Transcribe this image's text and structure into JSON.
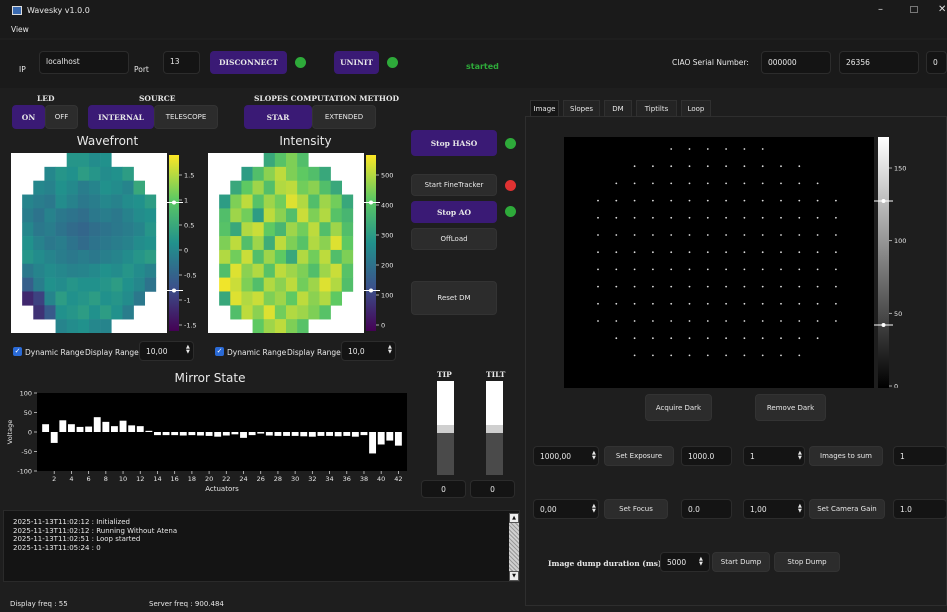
{
  "window": {
    "title": "Wavesky v1.0.0"
  },
  "menu": {
    "view": "View"
  },
  "connection": {
    "ip_label": "IP",
    "ip_value": "localhost",
    "port_label": "Port",
    "port_value": "13",
    "disconnect": "DISCONNECT",
    "uninit": "UNINIT",
    "status": "started",
    "ciao_label": "CIAO Serial Number:",
    "serial1": "000000",
    "serial2": "26356",
    "serial3": "0"
  },
  "led": {
    "title": "LED",
    "on": "ON",
    "off": "OFF"
  },
  "source": {
    "title": "SOURCE",
    "internal": "INTERNAL",
    "telescope": "TELESCOPE"
  },
  "slopes_method": {
    "title": "SLOPES COMPUTATION METHOD",
    "star": "STAR",
    "extended": "EXTENDED"
  },
  "wavefront": {
    "title": "Wavefront",
    "colorbar_ticks": [
      "1.5",
      "1",
      "0.5",
      "0",
      "-0.5",
      "-1",
      "-1.5"
    ],
    "colormap": "viridis",
    "grid": [
      [
        null,
        null,
        null,
        null,
        null,
        0.52,
        0.52,
        0.48,
        0.5,
        null,
        null,
        null,
        null,
        null
      ],
      [
        null,
        null,
        null,
        0.46,
        0.52,
        0.5,
        0.55,
        0.52,
        0.48,
        0.5,
        0.55,
        null,
        null,
        null
      ],
      [
        null,
        null,
        0.46,
        0.44,
        0.5,
        0.47,
        0.42,
        0.45,
        0.5,
        0.48,
        0.45,
        0.6,
        null,
        null
      ],
      [
        null,
        0.45,
        0.42,
        0.4,
        0.48,
        0.44,
        0.4,
        0.42,
        0.46,
        0.44,
        0.48,
        0.5,
        0.55,
        null
      ],
      [
        null,
        0.42,
        0.38,
        0.44,
        0.4,
        0.38,
        0.36,
        0.4,
        0.42,
        0.4,
        0.44,
        0.48,
        0.5,
        null
      ],
      [
        null,
        0.46,
        0.4,
        0.42,
        0.38,
        0.35,
        0.33,
        0.36,
        0.38,
        0.4,
        0.42,
        0.45,
        0.52,
        null
      ],
      [
        null,
        0.5,
        0.44,
        0.4,
        0.42,
        0.38,
        0.35,
        0.38,
        0.4,
        0.42,
        0.44,
        0.48,
        0.5,
        null
      ],
      [
        null,
        0.52,
        0.48,
        0.45,
        0.42,
        0.4,
        0.42,
        0.4,
        0.43,
        0.45,
        0.48,
        0.52,
        0.55,
        null
      ],
      [
        null,
        0.4,
        0.45,
        0.48,
        0.46,
        0.44,
        0.45,
        0.47,
        0.5,
        0.48,
        0.52,
        0.48,
        0.44,
        null
      ],
      [
        null,
        0.3,
        0.42,
        0.5,
        0.48,
        0.52,
        0.5,
        0.5,
        0.52,
        0.55,
        0.5,
        0.46,
        0.38,
        null
      ],
      [
        null,
        0.12,
        0.2,
        0.45,
        0.55,
        0.5,
        0.52,
        0.55,
        0.5,
        0.52,
        0.48,
        0.4,
        null,
        null
      ],
      [
        null,
        null,
        0.15,
        0.28,
        0.5,
        0.52,
        0.55,
        0.5,
        0.55,
        0.5,
        0.42,
        null,
        null,
        null
      ],
      [
        null,
        null,
        null,
        null,
        0.45,
        0.48,
        0.5,
        0.46,
        0.45,
        null,
        null,
        null,
        null,
        null
      ]
    ],
    "dynamic_range": "Dynamic Range",
    "display_range_label": "Display Range:",
    "display_range_value": "10,00"
  },
  "intensity": {
    "title": "Intensity",
    "colorbar_ticks": [
      "500",
      "400",
      "300",
      "200",
      "100",
      "0"
    ],
    "colormap": "viridis",
    "grid": [
      [
        null,
        null,
        null,
        null,
        null,
        0.6,
        0.72,
        0.8,
        0.7,
        null,
        null,
        null,
        null,
        null
      ],
      [
        null,
        null,
        null,
        0.55,
        0.7,
        0.82,
        0.9,
        0.8,
        0.75,
        0.7,
        0.6,
        null,
        null,
        null
      ],
      [
        null,
        null,
        0.6,
        0.75,
        0.85,
        0.7,
        0.88,
        0.9,
        0.78,
        0.82,
        0.7,
        0.6,
        null,
        null
      ],
      [
        null,
        0.55,
        0.8,
        0.9,
        0.72,
        0.85,
        0.78,
        0.95,
        0.88,
        0.7,
        0.85,
        0.78,
        0.6,
        null
      ],
      [
        null,
        0.7,
        0.85,
        0.78,
        0.55,
        0.9,
        0.82,
        0.7,
        0.92,
        0.8,
        0.88,
        0.72,
        0.66,
        null
      ],
      [
        null,
        0.72,
        0.6,
        0.88,
        0.92,
        0.75,
        0.66,
        0.85,
        0.78,
        0.9,
        0.7,
        0.85,
        0.7,
        null
      ],
      [
        null,
        0.8,
        0.9,
        0.7,
        0.85,
        0.62,
        0.9,
        0.8,
        0.72,
        0.88,
        0.82,
        0.95,
        0.75,
        null
      ],
      [
        null,
        0.88,
        0.78,
        0.92,
        0.7,
        0.85,
        0.75,
        0.6,
        0.88,
        0.78,
        0.9,
        0.7,
        0.8,
        null
      ],
      [
        null,
        0.7,
        0.95,
        0.82,
        0.88,
        0.72,
        0.9,
        0.85,
        0.8,
        0.7,
        0.85,
        0.92,
        0.72,
        null
      ],
      [
        null,
        0.98,
        0.92,
        0.8,
        0.7,
        0.88,
        0.82,
        0.9,
        0.78,
        0.85,
        0.95,
        0.88,
        0.7,
        null
      ],
      [
        null,
        0.6,
        0.95,
        0.88,
        0.92,
        0.8,
        0.85,
        0.75,
        0.9,
        0.82,
        0.88,
        0.75,
        null,
        null
      ],
      [
        null,
        null,
        0.7,
        0.9,
        0.82,
        0.95,
        0.78,
        0.88,
        0.85,
        0.8,
        0.72,
        null,
        null,
        null
      ],
      [
        null,
        null,
        null,
        null,
        0.75,
        0.85,
        0.9,
        0.8,
        0.72,
        null,
        null,
        null,
        null,
        null
      ]
    ],
    "dynamic_range": "Dynamic Range",
    "display_range_label": "Display Range:",
    "display_range_value": "10,0"
  },
  "controls": {
    "stop_haso": "Stop HASO",
    "start_finetracker": "Start FineTracker",
    "stop_ao": "Stop AO",
    "offload": "OffLoad",
    "reset_dm": "Reset DM"
  },
  "mirror_state": {
    "title": "Mirror State",
    "chart_data": {
      "type": "bar",
      "xlabel": "Actuators",
      "ylabel": "Voltage",
      "ylim": [
        -100,
        100
      ],
      "yticks": [
        "100",
        "50",
        "0",
        "-50",
        "-100"
      ],
      "xticks": [
        "2",
        "4",
        "6",
        "8",
        "10",
        "12",
        "14",
        "16",
        "18",
        "20",
        "22",
        "24",
        "26",
        "28",
        "30",
        "32",
        "34",
        "36",
        "38",
        "40",
        "42"
      ],
      "values": [
        20,
        -28,
        30,
        20,
        13,
        14,
        38,
        26,
        15,
        29,
        17,
        15,
        3,
        -8,
        -8,
        -8,
        -9,
        -8,
        -9,
        -10,
        -12,
        -9,
        -6,
        -15,
        -8,
        -4,
        -9,
        -10,
        -10,
        -10,
        -11,
        -12,
        -10,
        -10,
        -11,
        -10,
        -12,
        -8,
        -55,
        -32,
        -22,
        -35
      ]
    }
  },
  "tiptilt": {
    "tip": "TIP",
    "tilt": "TILT",
    "tip_value": "0",
    "tilt_value": "0",
    "tip_fill": 0.45,
    "tilt_fill": 0.45
  },
  "log": {
    "lines": [
      "2025-11-13T11:02:12 : Initialized",
      "2025-11-13T11:02:12 : Running Without Atena",
      "2025-11-13T11:02:51 : Loop started",
      "2025-11-13T11:05:24 : 0"
    ]
  },
  "status": {
    "display_freq": "Display freq : 55",
    "server_freq": "Server freq : 900.484"
  },
  "tabs": [
    "Image",
    "Slopes",
    "DM",
    "Tiptilts",
    "Loop"
  ],
  "camera": {
    "colorbar_ticks": [
      "150",
      "100",
      "50",
      "0"
    ],
    "acquire_dark": "Acquire Dark",
    "remove_dark": "Remove Dark",
    "exposure_input": "1000,00",
    "set_exposure": "Set Exposure",
    "exposure_value": "1000.0",
    "images_input": "1",
    "images_to_sum": "Images to sum",
    "images_value": "1",
    "focus_input": "0,00",
    "set_focus": "Set Focus",
    "focus_value": "0.0",
    "gain_input": "1,00",
    "set_camera_gain": "Set Camera Gain",
    "gain_value": "1.0",
    "dump_label": "Image dump duration (ms)",
    "dump_input": "5000",
    "start_dump": "Start Dump",
    "stop_dump": "Stop Dump"
  }
}
